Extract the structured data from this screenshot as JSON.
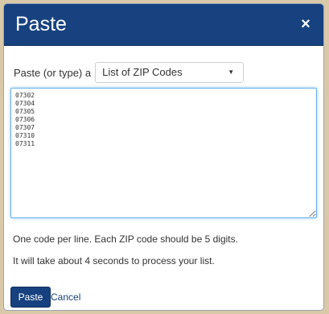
{
  "dialog": {
    "title": "Paste",
    "close_icon": "close-icon",
    "close_glyph": "×"
  },
  "input_row": {
    "label": "Paste (or type) a",
    "select_value": "List of ZIP Codes",
    "caret_icon": "caret-down-icon",
    "caret_glyph": "▼"
  },
  "textarea": {
    "value": "07302\n07304\n07305\n07306\n07307\n07310\n07311"
  },
  "notes": {
    "line1": "One code per line. Each ZIP code should be 5 digits.",
    "line2": "It will take about 4 seconds to process your list."
  },
  "buttons": {
    "paste_label": "Paste",
    "cancel_label": "Cancel"
  },
  "colors": {
    "header_bg": "#17427f",
    "primary_button": "#17427f",
    "link": "#17427f",
    "focus_border": "#66afe9"
  }
}
